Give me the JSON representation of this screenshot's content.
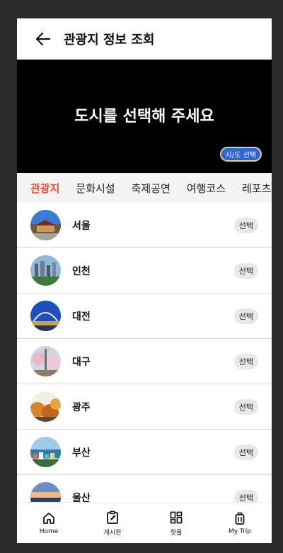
{
  "appbar": {
    "title": "관광지 정보 조회"
  },
  "hero": {
    "title": "도시를 선택해 주세요",
    "select_button": "시/도 선택"
  },
  "tabs": [
    {
      "label": "관광지",
      "active": true
    },
    {
      "label": "문화시설",
      "active": false
    },
    {
      "label": "축제공연",
      "active": false
    },
    {
      "label": "여행코스",
      "active": false
    },
    {
      "label": "레포츠",
      "active": false
    }
  ],
  "cities": [
    {
      "name": "서울",
      "button": "선택"
    },
    {
      "name": "인천",
      "button": "선택"
    },
    {
      "name": "대전",
      "button": "선택"
    },
    {
      "name": "대구",
      "button": "선택"
    },
    {
      "name": "광주",
      "button": "선택"
    },
    {
      "name": "부산",
      "button": "선택"
    },
    {
      "name": "울산",
      "button": "선택"
    }
  ],
  "bottom_nav": [
    {
      "label": "Home",
      "icon": "home-icon"
    },
    {
      "label": "게시판",
      "icon": "edit-board-icon"
    },
    {
      "label": "핫플",
      "icon": "grid-icon"
    },
    {
      "label": "My Trip",
      "icon": "luggage-icon"
    }
  ],
  "colors": {
    "accent": "#e2502f",
    "hero_bg": "#000000",
    "select_blue": "#2f63d6"
  }
}
